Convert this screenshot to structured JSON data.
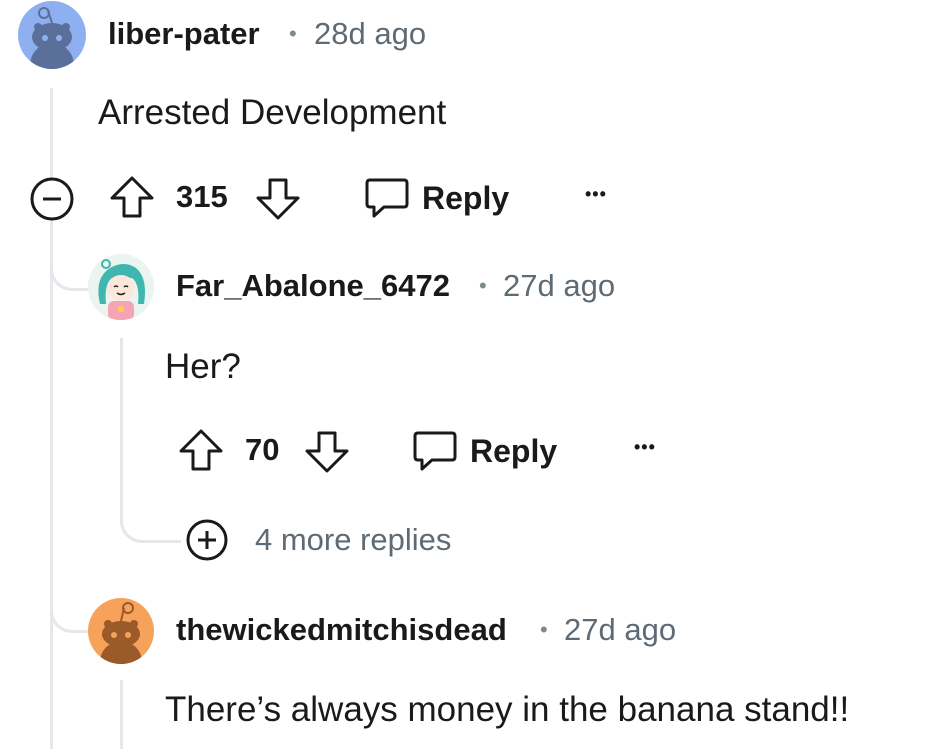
{
  "comments": [
    {
      "username": "liber-pater",
      "time": "28d ago",
      "body": "Arrested Development",
      "votes": "315",
      "reply_label": "Reply",
      "more_label": "•••"
    },
    {
      "username": "Far_Abalone_6472",
      "time": "27d ago",
      "body": "Her?",
      "votes": "70",
      "reply_label": "Reply",
      "more_label": "•••",
      "more_replies": "4 more replies"
    },
    {
      "username": "thewickedmitchisdead",
      "time": "27d ago",
      "body": "There’s always money in the banana stand!!"
    }
  ],
  "separator": "•",
  "colors": {
    "avatar1_bg": "#8fb0f0",
    "avatar3_bg": "#f6a25a",
    "thread_line": "#e5e7eb",
    "meta_text": "#5f6b74"
  }
}
